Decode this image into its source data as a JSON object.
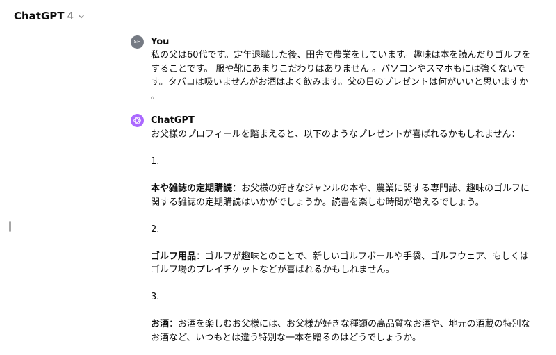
{
  "header": {
    "model_name": "ChatGPT",
    "model_version": "4"
  },
  "icons": {
    "model_dropdown": "chevron-down-icon",
    "assistant_avatar": "openai-logo-icon"
  },
  "colors": {
    "assistant_avatar_bg": "#ab68ff",
    "user_avatar_bg": "#757a83"
  },
  "user_message": {
    "avatar_initials": "SH",
    "author": "You",
    "text": "私の父は60代です。定年退職した後、田舎で農業をしています。趣味は本を読んだりゴルフをすることです。 服や靴にあまりこだわりはありません 。パソコンやスマホもには強くないです。タバコは吸いませんがお酒はよく飲みます。父の日のプレゼントは何がいいと思いますか 。"
  },
  "assistant_message": {
    "author": "ChatGPT",
    "intro": "お父様のプロフィールを踏まえると、以下のようなプレゼントが喜ばれるかもしれません：",
    "items": [
      {
        "number": "1.",
        "title": "本や雑誌の定期購読",
        "text": "：お父様の好きなジャンルの本や、農業に関する専門誌、趣味のゴルフに関する雑誌の定期購読はいかがでしょうか。読書を楽しむ時間が増えるでしょう。"
      },
      {
        "number": "2.",
        "title": "ゴルフ用品",
        "text": "：ゴルフが趣味とのことで、新しいゴルフボールや手袋、ゴルフウェア、もしくはゴルフ場のプレイチケットなどが喜ばれるかもしれません。"
      },
      {
        "number": "3.",
        "title": "お酒",
        "text": "：お酒を楽しむお父様には、お父様が好きな種類の高品質なお酒や、地元の酒蔵の特別なお酒など、いつもとは違う特別な一本を贈るのはどうでしょうか。"
      }
    ]
  }
}
